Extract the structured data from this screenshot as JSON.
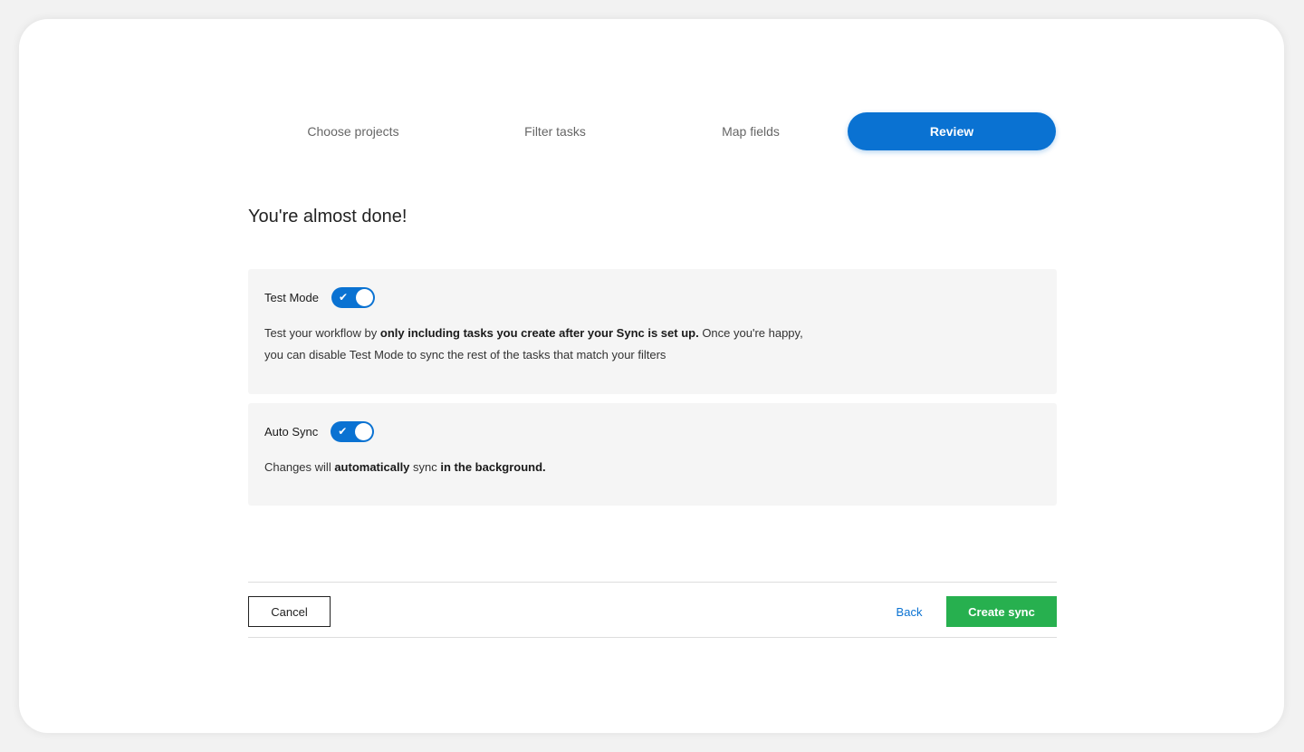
{
  "steps": [
    {
      "label": "Choose projects"
    },
    {
      "label": "Filter tasks"
    },
    {
      "label": "Map fields"
    },
    {
      "label": "Review",
      "active": true
    }
  ],
  "heading": "You're almost done!",
  "test_mode": {
    "title": "Test Mode",
    "enabled": true,
    "text_1": "Test your workflow by ",
    "text_bold_1": "only including tasks you create after your Sync is set up.",
    "text_2": " Once you're happy,",
    "text_3": "you can disable Test Mode to sync the rest of the tasks that match your filters"
  },
  "auto_sync": {
    "title": "Auto Sync",
    "enabled": true,
    "text_1": "Changes will ",
    "text_bold_1": "automatically",
    "text_2": " sync ",
    "text_bold_2": "in the background."
  },
  "footer": {
    "cancel_label": "Cancel",
    "back_label": "Back",
    "create_label": "Create sync"
  },
  "colors": {
    "primary": "#0a72d2",
    "success": "#27b04f"
  },
  "icons": {
    "toggle_check": "✔"
  }
}
